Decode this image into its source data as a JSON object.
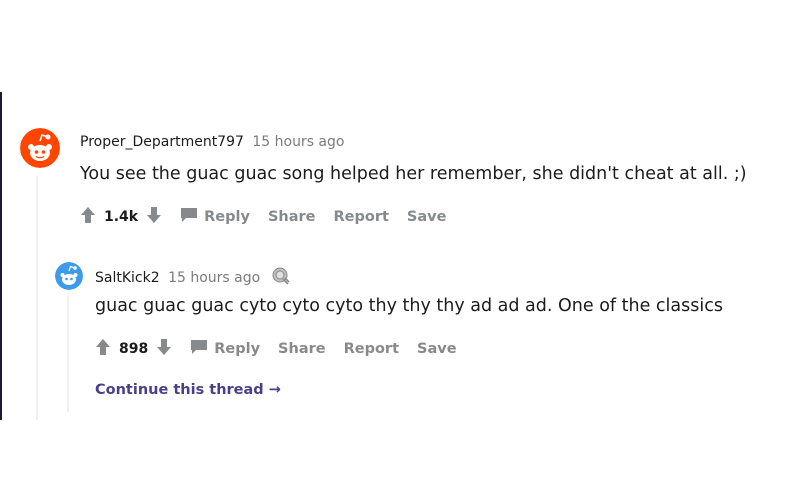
{
  "comments": [
    {
      "username": "Proper_Department797",
      "time": "15 hours ago",
      "body": "You see the guac guac song helped her remember, she didn't cheat at all. ;)",
      "votes": "1.4k",
      "avatar_icon": "snoo-orange-avatar-icon"
    },
    {
      "username": "SaltKick2",
      "time": "15 hours ago",
      "body": "guac guac guac cyto cyto cyto thy thy thy ad ad ad. One of the classics",
      "votes": "898",
      "avatar_icon": "snoo-blue-avatar-icon",
      "award_icon": "award-icon"
    }
  ],
  "actions": {
    "reply": "Reply",
    "share": "Share",
    "report": "Report",
    "save": "Save"
  },
  "continue_thread": "Continue this thread",
  "colors": {
    "meta_gray": "#7c7c7c",
    "action_gray": "#878a8c",
    "link_purple": "#4a3f8c",
    "avatar_orange": "#ff4500",
    "avatar_blue": "#3d9be9"
  }
}
